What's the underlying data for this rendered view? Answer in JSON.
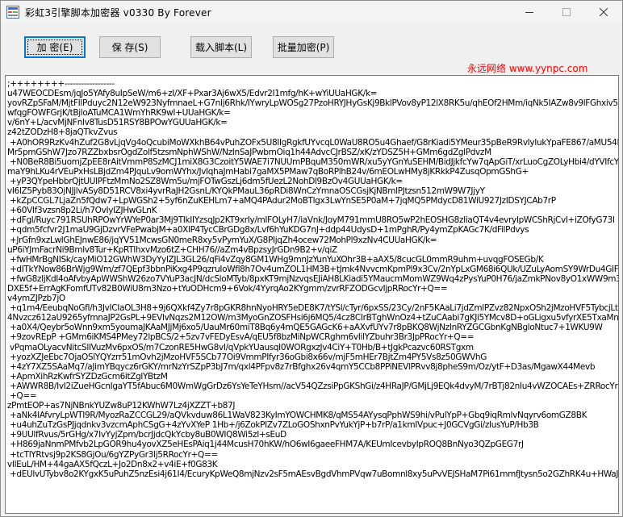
{
  "window": {
    "title": "彩虹3引擎脚本加密器 v0330  By  Forever"
  },
  "toolbar": {
    "encrypt_label": "加 密(E)",
    "save_label": "保 存(S)",
    "load_label": "载入脚本(L)",
    "batch_label": "批量加密(P)"
  },
  "website": "永远网络 www.yynpc.com",
  "editor": {
    "lines": [
      ";++++++++------------------",
      "u47WEOCDEsm/jqJo5YAfy8uIpSeW/m6+zI/XF+Pxar3Aj6wX5/Edvr2I1mfg/hK+wYiUUaHGK/k=",
      "yovRZpSFaM/MjtFIlPduyc2N12eW923NyfmnaeL+G7nIj6Rhk/IYwryLpWOSg27PzoHRYJHyGsKj9BklPVov8yP12lX8RK5u/qhEOf2HMm/iqNk5IAZw8v9lFGhxiv5",
      "wfqgFOWFGrjK/tBjloATuMCA1WmYhRK9wI+UUaHGK/k=",
      "v/6nY+L/acvMjNFnlv8TusD51RSY8BPOwYGUUaHGK/k=",
      "z42tZODzH8+8jaQTkvZvus",
      " +A0hOR9RzKv4hZuf2G8vLjqVg4oQcubiMoWXkhB64vPuhZOFx5U8IIgRgkfUYvcqL0WaU8RO5u4Ghaef/G8rKiadi5YMeur35pBeR9RvIyIukYpaFE867/aMU54MZy",
      "Mr5pmGShW7Jzo7RZZbxbsrOgdZolf5tzsmNphWShW/NzInSaJPwbrnOiq1h44AdvcCJrBSZ/xK/zYDSZ5H+GMm6gdZglPdvzM",
      " +N0BeR8Bi5uomjZpEE8rAitVmmP8SzMCJ1miX8G3CzoitY5WAE7i7NUUmPBquM350mWR/xu5yYGnYuSEHM/BidJjkfcYw7qApGiT/xrLuoCgZOLyHbi4/dYVIfcYvbqKo",
      "maY9hLKu4rVEuPxHsLBjdZm4PJquLv9omWYhx/JvIqhaJmHabi7gaMX5PMaw7qBoRPlhB24v/6mEOLwHMy8jKRkkP4ZusqOpmGShG+",
      " +yP3QYpeHbbrQjtUUlPFtzMmNo2SZ8Wm5u/mjFOTwGszLj6dm5fUezL2NohDl9BzOv4GUUaHGK/k=",
      "vI6lZ5Pyb83OjNJjlvASy8D51RCV8xi4yvrRaJH2GsnL/KYQkPMauL36pRDi8WnCzYmnaOSCGsjKjNBmlPJtzsn512mW9W7JjyY",
      " +kZpCCGL7LjaZn5fQdw7+LpWGSh2+5yf6nZuKEHLm7+aMQ4PAdur2MoBTlgx3LwYnSE5P0aM+7jqMQ5PMdycD81WiU927JzIDSYJCAb7rP",
      " +60VIf3vzsn8p2Li/h7OvIylZJHwGLnK",
      " +dFgl/Ruyc791RSUhRPOwYrWYeP0ar3Mj9TIkIIYzsqJp2KT9xrIy/mIFOLyH7/iaVnk/JoyM791mmU8RO5wP2hEOSHG8zIiaQT4v4evryIpWCShRjCvI+iZOfyG73I",
      " +qdm5fcfvr2J1maU9GjDzvrVFePwabjM+a0XlP4TycCBrGDg8x/Lvf6hYuKDG7nJ+ddp44UdysD+1mPghR/Py4ymZpKAGc7K/dFilPdvys",
      " +JrGfn9xzLwIGhEJnwE86/jqYV51McwsGN0meR8xy5vPymYuX/G8PIjqZh4ocew72MohPl9xzNv4CUUaHGK/k=",
      "uP6iYJmFacrNi9Bmlv8Tur+KpRTlhxvMzo6tZ+CHH76//aZm4vBpzsyJrGDn9B2+v/qiZ",
      " +fwHMrBgNISk/cayMiO12GWhW3DyYylZJL3GL26/qFi4vZqy8GM1WHg9mnJzYunYuXOhr3B+aAX5/8cucGL0mmR9uhm+uvqgFOSEGb/K",
      " +dITkYNow86BrWjg9Wm/zf7QEpf3bbnPiKxg4P9qzruIoWfl8h7Ov4umZOL1HM3B+tJmk4NvvcmKpmPl9x3Cv/2nYpLxGM68i6QUk/UZuLyAomSY9WrDu4GIF",
      " +fwG8zIjKdI4oAfvbyApWWShW26zo7VYuP3acJN/dcSloMTyb/8pxKT9mjNzvqsEJiAH8LKiadi5YMaucmMomWZ9Wq4zPysYuP0H76/jaZmkPNov8yO1xWW9m3DyI",
      "DXE5f+ErrAgKFomfUTv82B0WiU8m3Nzo+tYuODHcm9+6Vok/4YyrqAo2KYgmm/zvrRFZODGcvIjpRRocYr+Q==",
      "v4ymZJPzb7jO",
      " +q1m4/EeubqNoGfl/h3JvICIaOL3H8+9j6QXkf4Zy7r8pGKR8hnNyoHRY5eDE8K7/tYSl/cTyr/6pxSS/23Cy/2nF5KAaLi7jdZmlPZvz82NpxOSh2jMzoHVF5TybcjLtBmI",
      "4Nvzcz612aU9265yfmnaJP2GsPL+9EVlvNqzs2M12OW/m3MyoGnZOSFHsi6j6MQ5/4cz8CIrBTghWnOz4+tZuCAabi7gKJi5YMcv8D+oGLigxu5vfyrXE5TxaMnO",
      " +a0X4/Qeybr5oWnn9xm5youmaJKAaMJjMj6xo5/UauMr60miT8Bq6y4mQE5GAGcK6+aAXvfUYv7r8pBKQ8WjNzInRYZGCGbnKgNBgloNtuc7+1WKU9W",
      " +9zovREpP +GMm6iKMS4PMey72lpBCS/2+5zv7vFEDyEsvA/qEU5f8bzMiNpWCRghm6vIilYZbuhr3Br3JpPRocYr+Q==",
      " vPqmaOLyacvNitcSlIVuzMv6pxOS/m7CzonRE5HwG8vI/qVpkYUausqI0WORgxzJv4CiY+T0Hb/B+tJgkPcazvc60RSTgxm",
      " +yozXZJeEbc7OjaOSlYQYzrr51mOvh2jMzoHVF5SCb77Oi9VmmPIfyr36oGbi8x66v/mjF5mHEr7BjtZm4PY5Vs8z50GWVhG",
      " +4zY7XZ5SAaMq7/aJimYBqycz6rGKY/mrNzYrSZpP3bJ7m/qxl4PFpv8z7rBfghx26v4qmY5CCb8PPiNEVlPRvv8j8pheS9m/Oz/ytF+D3as/MgawX44Mevb",
      " +ApmXihRzKwfrSYZDzGcm6itZglYBtzM",
      " +AWWR8B/IvI2iZueHGcnIgaYT5fAbuc6M0WmWgGrDz6YsYeTeYHsm//acV54QZzsiPpGKShGi/z4HRaJP/GMjLj9EQk4dvyM/7rBTj82nIu4vWZOCAEs+ZRRocYr",
      " +Q==",
      "zPmtEOP+as7NjNBnkYUZw8uP12KWhW7Lz4jXZZT+b87J",
      " +aNk4IAfvryLpWTI9R/MyozRaZCCGL29/aQVkvduw86L1WaV823KyImYOWCHMK8/qMS54AYysqPphWS9hi/vPulYpP+Gbq9iqRmlvNqyrv6omGZ8BK",
      " +u4uhZuTzGsPJjqdnkv3vzcmAphCSgG+4zYvXYeP 1Hb+/j6ZokPIZv7ZLoGOShxnPvYukYjP+b7rP/a1kmIVpuc+J0GCVgGi/zIusYuP/Hb3B",
      " +9UUlfRvus/5rGHg/x7IvYyjZpm/bcrJjdcQkYcby8uB0WIQ8Wi5zI+sEuD",
      " +H869jaNnmPMfvb2LpGOR9hu4yovXZ5eHEsPAiq1j44McusH70hKW/hO6wI6gaeeFHM7A/KEUmIcevbyIpROQ8BnNyo3QZpGEG7rJ",
      " +tcTlYRtvsj9p2KS8GjOu/6gYZPyGr3Ij5RRocYr+Q==",
      "vIlEuL/HM+44gaAX5fQczL+Jo2Dn8x2+v4iE+f0G83K",
      " +dEUlvUTybv8o2KYgxK5uPuhZ5nzEsi4j61I4/EcuryKpWeQ8mjNzv2sF5mAEsvBgdVhmPVqw7uBomnl8xy5uPvVEJSHaM7Pi61mmfJtysn5o2GZhRK4u+HWaJWHaL"
    ]
  }
}
